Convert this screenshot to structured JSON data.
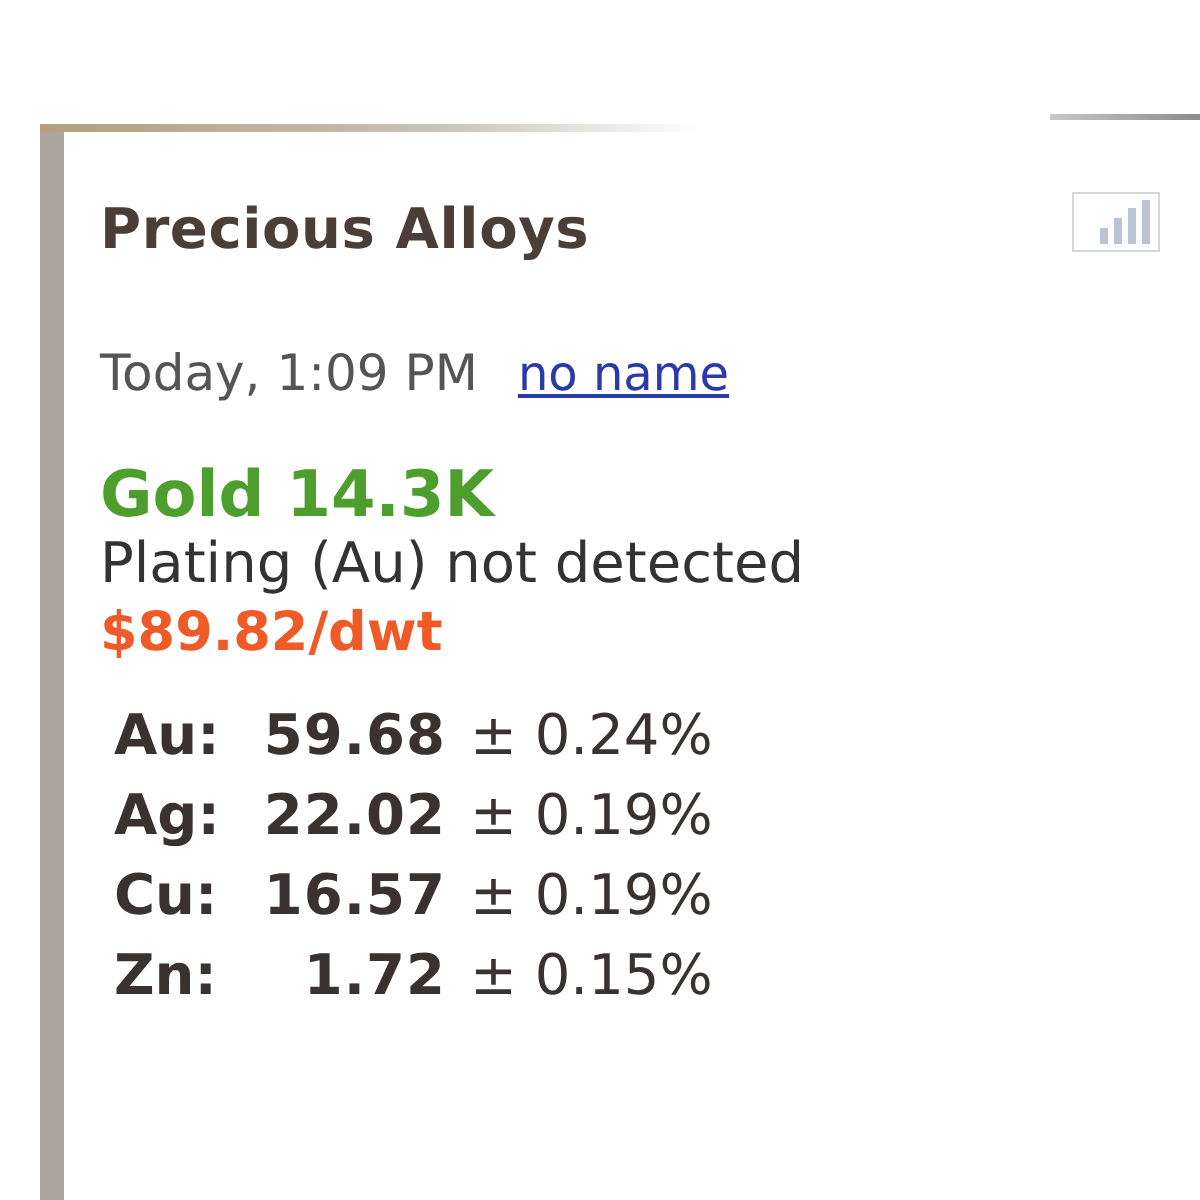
{
  "header": {
    "title": "Precious Alloys"
  },
  "sample": {
    "time": "Today, 1:09 PM",
    "name": "no name"
  },
  "result": {
    "grade": "Gold 14.3K",
    "note": "Plating (Au) not detected",
    "price": "$89.82/dwt"
  },
  "elements": [
    {
      "symbol": "Au:",
      "value": "59.68",
      "error": "± 0.24%"
    },
    {
      "symbol": "Ag:",
      "value": "22.02",
      "error": "± 0.19%"
    },
    {
      "symbol": "Cu:",
      "value": "16.57",
      "error": "± 0.19%"
    },
    {
      "symbol": "Zn:",
      "value": "1.72",
      "error": "± 0.15%"
    }
  ]
}
